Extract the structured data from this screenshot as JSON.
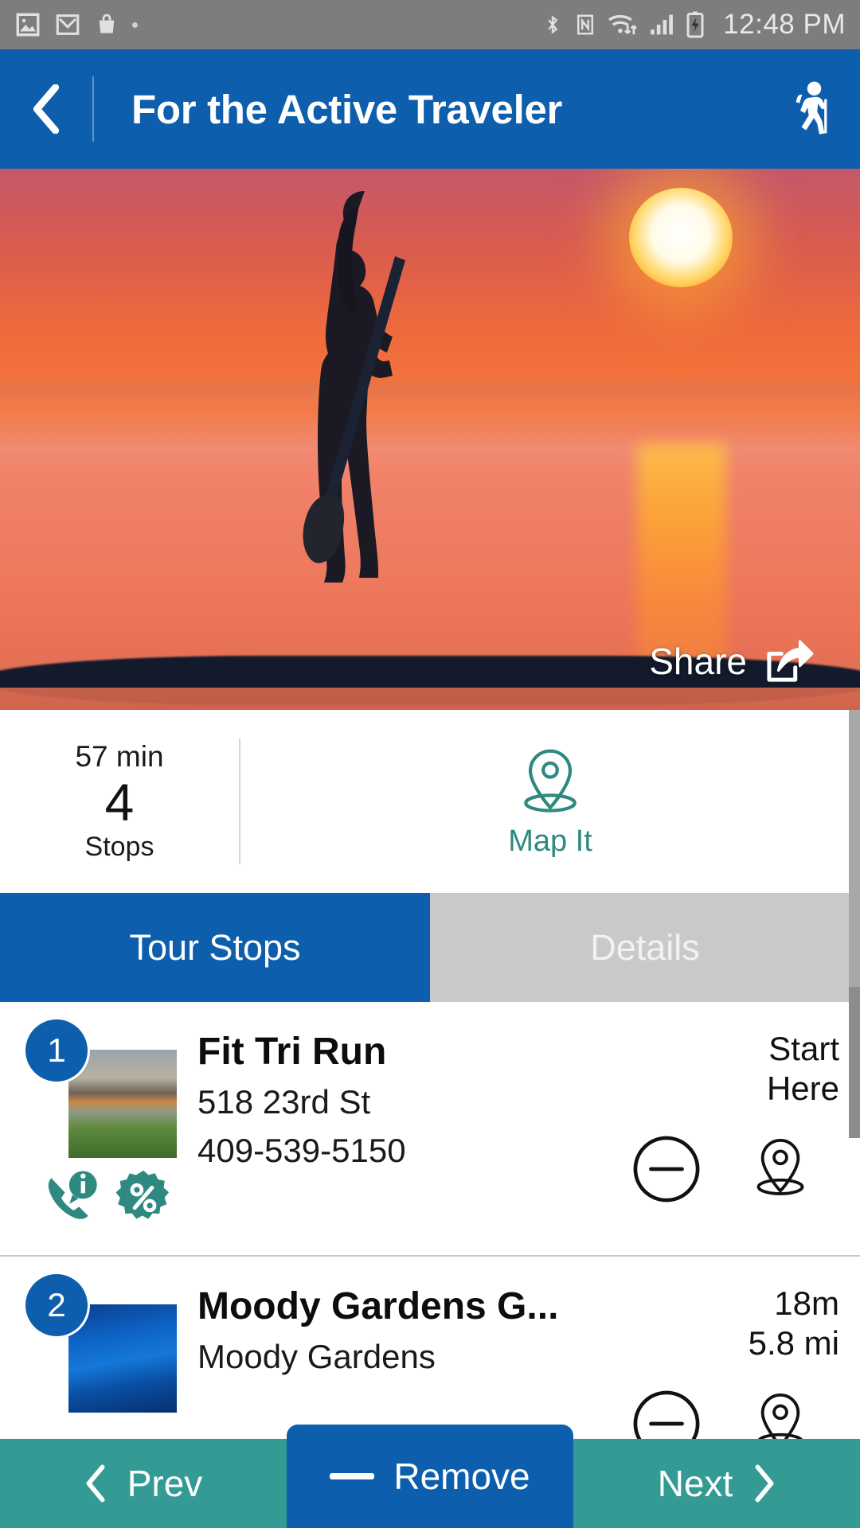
{
  "statusbar": {
    "time": "12:48 PM",
    "icons": [
      "photos-icon",
      "gmail-icon",
      "shopping-bag-icon",
      "dot-indicator-icon",
      "bluetooth-icon",
      "nfc-icon",
      "wifi-icon",
      "cellular-signal-icon",
      "battery-charging-icon"
    ]
  },
  "appbar": {
    "back_icon": "chevron-left-icon",
    "title": "For the Active Traveler",
    "action_icon": "hiker-icon"
  },
  "hero": {
    "alt": "paddleboarder-at-sunset",
    "share_label": "Share",
    "share_icon": "share-arrow-icon"
  },
  "stats": {
    "duration": "57 min",
    "stop_count": "4",
    "stop_label": "Stops",
    "map_icon": "map-pin-icon",
    "map_label": "Map It",
    "accent_color": "#2e8a80"
  },
  "tabs": [
    {
      "label": "Tour Stops",
      "active": true
    },
    {
      "label": "Details",
      "active": false
    }
  ],
  "stops": [
    {
      "number": "1",
      "title": "Fit Tri Run",
      "line1": "518 23rd St",
      "line2": "409-539-5150",
      "right_line1": "Start",
      "right_line2": "Here",
      "icons": [
        "phone-info-icon",
        "discount-percent-icon"
      ],
      "actions": [
        "remove-circle-icon",
        "map-pin-icon"
      ]
    },
    {
      "number": "2",
      "title": "Moody Gardens G...",
      "line1": "Moody Gardens",
      "line2": "",
      "right_line1": "18m",
      "right_line2": "5.8 mi",
      "icons": [],
      "actions": [
        "remove-circle-icon",
        "map-pin-icon"
      ]
    }
  ],
  "bottombar": {
    "prev_label": "Prev",
    "prev_icon": "chevron-left-icon",
    "remove_label": "Remove",
    "remove_icon": "minus-icon",
    "next_label": "Next",
    "next_icon": "chevron-right-icon",
    "bar_color": "#339b94",
    "remove_color": "#0d5fae"
  }
}
